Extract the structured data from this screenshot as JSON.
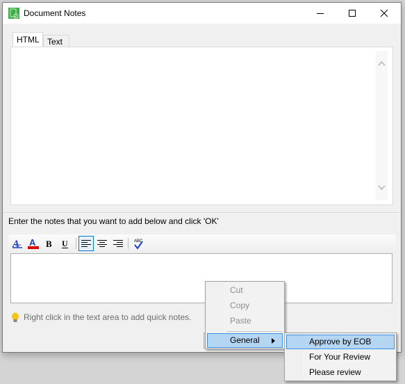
{
  "window": {
    "title": "Document Notes",
    "controls": {
      "minimize": "minimize",
      "maximize": "maximize",
      "close": "close"
    }
  },
  "tabs": [
    {
      "label": "HTML",
      "active": true
    },
    {
      "label": "Text",
      "active": false
    }
  ],
  "instructions": "Enter the notes that you want to add below and click 'OK'",
  "toolbar": {
    "items": [
      {
        "icon": "font-style-icon",
        "label": "Font"
      },
      {
        "icon": "font-color-icon",
        "label": "Font Color",
        "color": "#e00000"
      },
      {
        "icon": "bold-icon",
        "label": "B"
      },
      {
        "icon": "underline-icon",
        "label": "U"
      },
      {
        "icon": "align-left-icon",
        "selected": true
      },
      {
        "icon": "align-center-icon"
      },
      {
        "icon": "align-right-icon"
      },
      {
        "icon": "spellcheck-icon",
        "label": "ABC"
      }
    ]
  },
  "notes_input": {
    "value": ""
  },
  "hint": "Right click in the text area to add quick notes.",
  "context_menu": {
    "items": [
      {
        "label": "Cut",
        "disabled": true
      },
      {
        "label": "Copy",
        "disabled": true
      },
      {
        "label": "Paste",
        "disabled": true
      },
      {
        "label": "General",
        "submenu": true,
        "highlighted": true
      }
    ],
    "submenu": [
      {
        "label": "Approve by EOB",
        "highlighted": true
      },
      {
        "label": "For Your Review"
      },
      {
        "label": "Please review"
      }
    ]
  },
  "colors": {
    "accent": "#0078d7",
    "highlight": "#b5d6f3",
    "app_icon": "#3fae49"
  }
}
